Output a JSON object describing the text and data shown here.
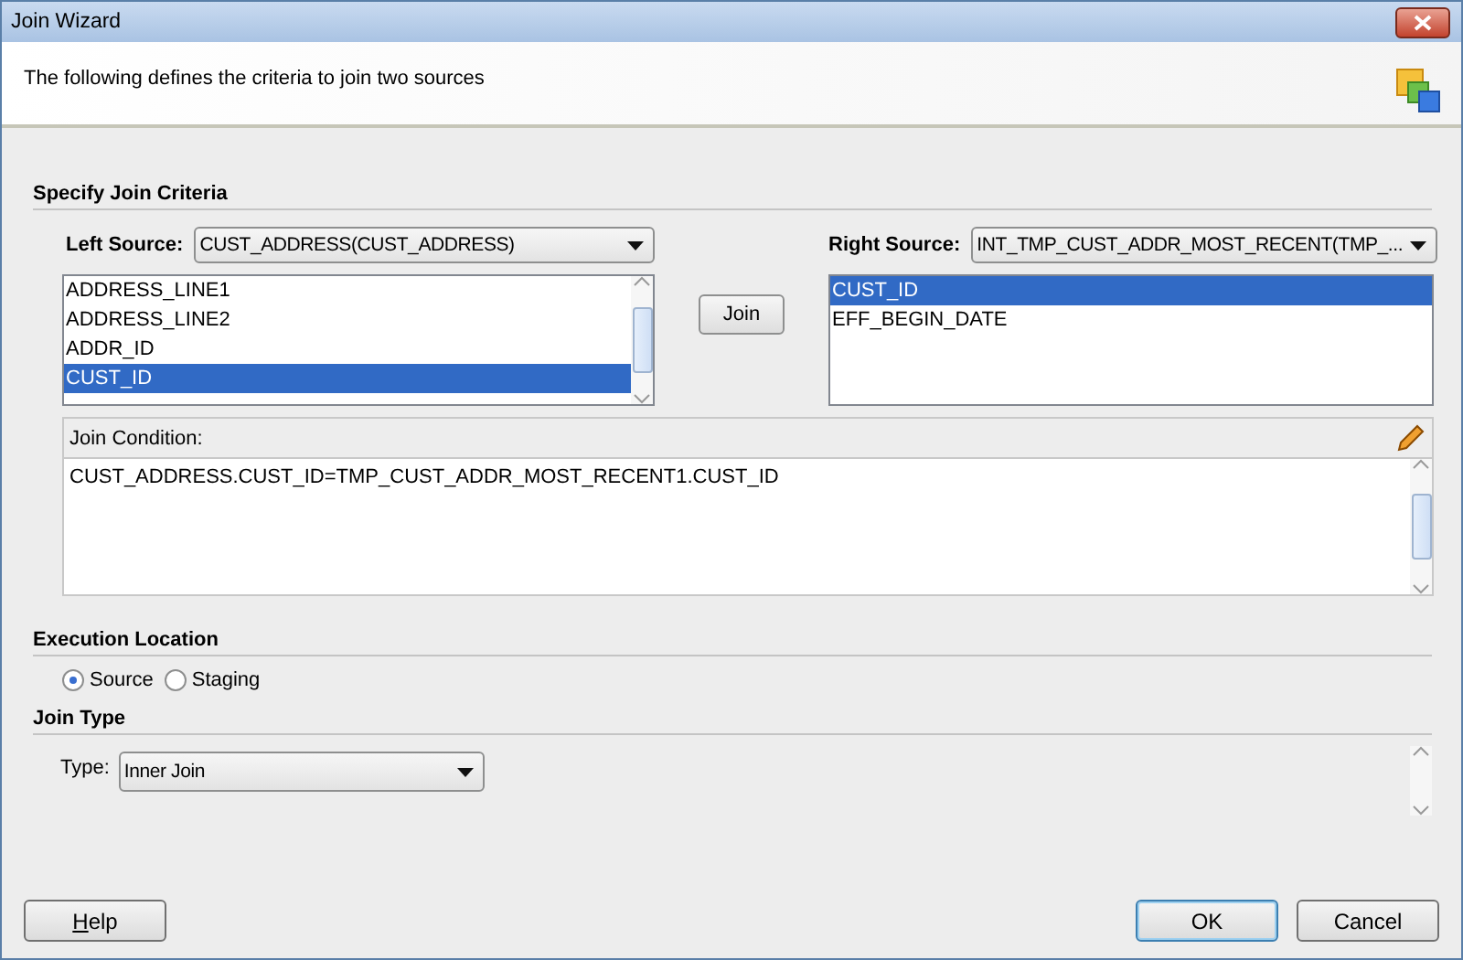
{
  "window": {
    "title": "Join Wizard"
  },
  "header": {
    "description": "The following defines the criteria to join two sources"
  },
  "join_criteria": {
    "heading": "Specify Join Criteria",
    "left_source": {
      "label": "Left Source:",
      "value": "CUST_ADDRESS(CUST_ADDRESS)",
      "items": [
        {
          "label": "ADDRESS_LINE1",
          "selected": false
        },
        {
          "label": "ADDRESS_LINE2",
          "selected": false
        },
        {
          "label": "ADDR_ID",
          "selected": false
        },
        {
          "label": "CUST_ID",
          "selected": true
        }
      ]
    },
    "join_button": "Join",
    "right_source": {
      "label": "Right Source:",
      "value": "INT_TMP_CUST_ADDR_MOST_RECENT(TMP_...",
      "items": [
        {
          "label": "CUST_ID",
          "selected": true
        },
        {
          "label": "EFF_BEGIN_DATE",
          "selected": false
        }
      ]
    },
    "join_condition": {
      "label": "Join Condition:",
      "value": "CUST_ADDRESS.CUST_ID=TMP_CUST_ADDR_MOST_RECENT1.CUST_ID"
    }
  },
  "execution_location": {
    "heading": "Execution Location",
    "options": [
      {
        "label": "Source",
        "selected": true
      },
      {
        "label": "Staging",
        "selected": false
      }
    ]
  },
  "join_type": {
    "heading": "Join Type",
    "label": "Type:",
    "value": "Inner Join"
  },
  "buttons": [
    {
      "label": "Help",
      "kind": "help"
    },
    {
      "label": "OK",
      "kind": "default"
    },
    {
      "label": "Cancel",
      "kind": "normal"
    }
  ]
}
